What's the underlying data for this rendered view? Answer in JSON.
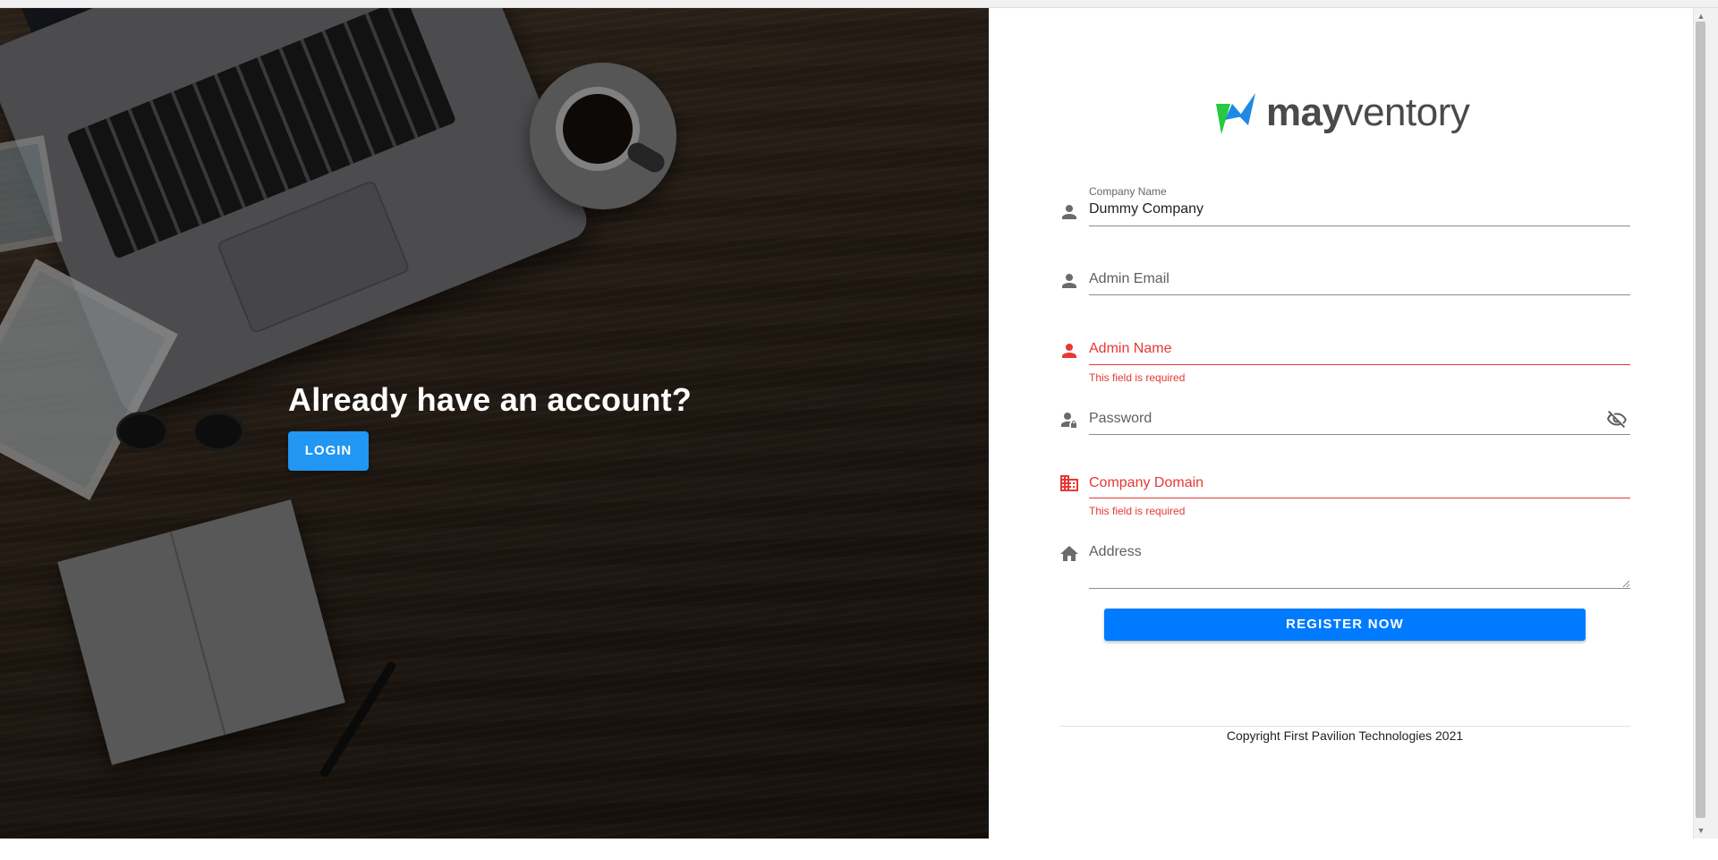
{
  "hero": {
    "heading": "Already have an account?",
    "login_label": "LOGIN"
  },
  "logo": {
    "text_bold": "may",
    "text_regular": "ventory",
    "mark_colors": [
      "#27c93f",
      "#1e88e5"
    ]
  },
  "form": {
    "company_name": {
      "label": "Company Name",
      "value": "Dummy Company",
      "icon": "person-icon"
    },
    "admin_email": {
      "placeholder": "Admin Email",
      "icon": "person-icon"
    },
    "admin_name": {
      "placeholder": "Admin Name",
      "icon": "person-icon",
      "error": "This field is required"
    },
    "password": {
      "placeholder": "Password",
      "icon": "person-lock-icon",
      "toggle_icon": "eye-off-icon"
    },
    "company_domain": {
      "placeholder": "Company Domain",
      "icon": "building-icon",
      "error": "This field is required"
    },
    "address": {
      "placeholder": "Address",
      "icon": "home-icon"
    },
    "register_label": "REGISTER NOW"
  },
  "footer": {
    "copyright": "Copyright First Pavilion Technologies 2021"
  },
  "colors": {
    "primary": "#007bff",
    "login_button": "#2196f3",
    "error": "#e53935",
    "text_dark": "#222222"
  }
}
